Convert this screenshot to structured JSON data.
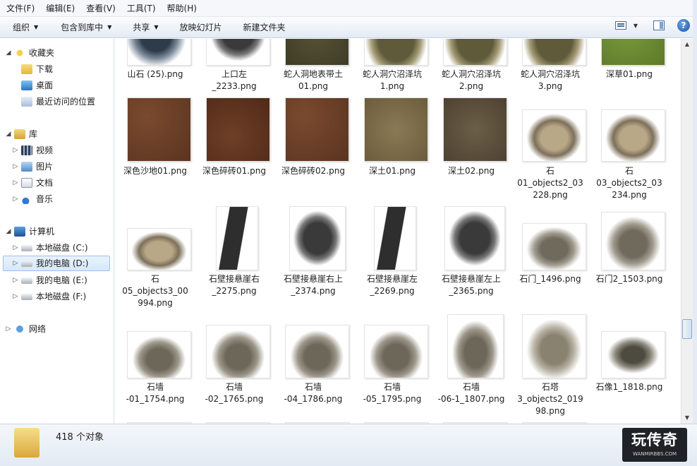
{
  "menu": [
    "文件(F)",
    "编辑(E)",
    "查看(V)",
    "工具(T)",
    "帮助(H)"
  ],
  "toolbar": {
    "organize": "组织",
    "include": "包含到库中",
    "share": "共享",
    "slideshow": "放映幻灯片",
    "newfolder": "新建文件夹",
    "help": "?"
  },
  "nav": {
    "favorites": "收藏夹",
    "downloads": "下载",
    "desktop": "桌面",
    "recent": "最近访问的位置",
    "libraries": "库",
    "videos": "视频",
    "pictures": "图片",
    "documents": "文档",
    "music": "音乐",
    "computer": "计算机",
    "drive_c": "本地磁盘 (C:)",
    "drive_d": "我的电脑 (D:)",
    "drive_e": "我的电脑 (E:)",
    "drive_f": "本地磁盘 (F:)",
    "network": "网络"
  },
  "files": [
    {
      "name": "山石 (25).png"
    },
    {
      "name": "上口左\n_2233.png"
    },
    {
      "name": "蛇人洞地表带土\n01.png"
    },
    {
      "name": "蛇人洞穴沼泽坑\n1.png"
    },
    {
      "name": "蛇人洞穴沼泽坑\n2.png"
    },
    {
      "name": "蛇人洞穴沼泽坑\n3.png"
    },
    {
      "name": "深草01.png"
    },
    {
      "name": "深色沙地01.png"
    },
    {
      "name": "深色碎砖01.png"
    },
    {
      "name": "深色碎砖02.png"
    },
    {
      "name": "深土01.png"
    },
    {
      "name": "深土02.png"
    },
    {
      "name": "石\n01_objects2_03\n228.png"
    },
    {
      "name": "石\n03_objects2_03\n234.png"
    },
    {
      "name": "石\n05_objects3_00\n994.png"
    },
    {
      "name": "石壁接悬崖右\n_2275.png"
    },
    {
      "name": "石壁接悬崖右上\n_2374.png"
    },
    {
      "name": "石壁接悬崖左\n_2269.png"
    },
    {
      "name": "石壁接悬崖左上\n_2365.png"
    },
    {
      "name": "石门_1496.png"
    },
    {
      "name": "石门2_1503.png"
    },
    {
      "name": "石墙\n-01_1754.png"
    },
    {
      "name": "石墙\n-02_1765.png"
    },
    {
      "name": "石墙\n-04_1786.png"
    },
    {
      "name": "石墙\n-05_1795.png"
    },
    {
      "name": "石墙\n-06-1_1807.png"
    },
    {
      "name": "石塔\n3_objects2_019\n98.png"
    },
    {
      "name": "石像1_1818.png"
    }
  ],
  "status": {
    "count": "418 个对象"
  },
  "watermark": {
    "text": "玩传奇",
    "sub": "WANMIRBBS.COM"
  }
}
